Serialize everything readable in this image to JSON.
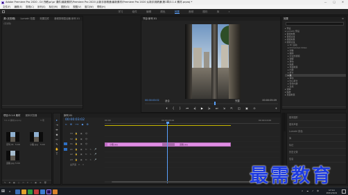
{
  "window": {
    "title": "Adobe Premiere Pro 2020 - D:\\书稿\\pr\\pr 课件\\最新素材\\Premiere Pro 2020 从新手到精通\\最新素材\\Premiere Pro 2020 从新手到精通\\第1章\\3.1.4 素材.prproj *",
    "controls": "— □ ✕"
  },
  "menu": [
    "文件(F)",
    "编辑(E)",
    "剪辑(C)",
    "序列(S)",
    "标记(M)",
    "图形(G)",
    "视图(V)",
    "窗口(W)",
    "帮助(H)"
  ],
  "workspaces": {
    "items": [
      "学习",
      "组件",
      "编辑",
      "颜色",
      "效果",
      "音频",
      "图形",
      "库"
    ],
    "active_index": 4,
    "more": "»"
  },
  "source_panel": {
    "tabs": [
      "源:(无剪辑)",
      "Lumetri 范围",
      "效果控件",
      "音频剪辑混合器:序列 01"
    ],
    "active_tab": 0,
    "subtitle": "(无剪辑)"
  },
  "program_panel": {
    "tab": "节目:序列 01",
    "timecode_current": "00:00:03:02",
    "fit": "适合",
    "quality": "完整",
    "timecode_duration": "00:00:05:09",
    "transport": [
      "⏴",
      "{",
      "}",
      "⏮",
      "◂|",
      "▶",
      "|▸",
      "⏭",
      "⇲",
      "⇱",
      "◫",
      "▣",
      "⊙"
    ],
    "add_button": "+"
  },
  "effects_panel": {
    "tab": "效果",
    "menu": "≡",
    "items": [
      {
        "label": "▸ 预设",
        "indent": 0
      },
      {
        "label": "▸ Lumetri 预设",
        "indent": 0
      },
      {
        "label": "▸ 音频效果",
        "indent": 0
      },
      {
        "label": "▸ 音频过渡",
        "indent": 0
      },
      {
        "label": "▸ 视频效果",
        "indent": 0
      },
      {
        "label": "▾ 视频过渡",
        "indent": 0
      },
      {
        "label": "▸ 3D 运动",
        "indent": 1
      },
      {
        "label": "▸ Immersive Video",
        "indent": 1
      },
      {
        "label": "▸ 划像",
        "indent": 1
      },
      {
        "label": "▸ 擦除",
        "indent": 1
      },
      {
        "label": "▸ 沉浸式视频",
        "indent": 1
      },
      {
        "label": "▸ 溶解",
        "indent": 1
      },
      {
        "label": "▸ 滑动",
        "indent": 1
      },
      {
        "label": "▸ 缩放",
        "indent": 1
      },
      {
        "label": "▸ 页面剥落",
        "indent": 1
      },
      {
        "label": "▸ 内滑",
        "indent": 1
      },
      {
        "label": "▸ 拆分",
        "indent": 1
      },
      {
        "label": "▸ 推",
        "indent": 1
      },
      {
        "label": "▸ 滑动",
        "indent": 1
      },
      {
        "label": "▸ 中心拆分",
        "indent": 1
      },
      {
        "label": "▸ 带状内滑",
        "indent": 1
      },
      {
        "label": "▸ 急摇",
        "indent": 1
      },
      {
        "label": "▸ 溶解",
        "indent": 0
      },
      {
        "label": "▸ 缩放",
        "indent": 0
      },
      {
        "label": "▸ 页面剥落",
        "indent": 0
      }
    ],
    "selected_index": 17
  },
  "project_panel": {
    "tabs": [
      "项目:3.1.4 素材",
      "媒体浏览器"
    ],
    "active_tab": 0,
    "path": "3.1.4 素材.prproj",
    "item_count": "3 项",
    "clips": [
      {
        "name": "序列 01",
        "duration": "5:09"
      },
      {
        "name": "小路.jpg",
        "duration": "5:00"
      },
      {
        "name": "道路.jpg",
        "duration": "5:00"
      }
    ],
    "bottom_icons": "✎ ≣ ▦ ○ ▭ ▾ ⌕ ▣ ⊕ 🗑"
  },
  "tools": [
    "▸",
    "⇥",
    "⇼",
    "◆",
    "↔",
    "✎",
    "✋",
    "T"
  ],
  "timeline": {
    "tab": "序列 01",
    "timecode": "00:00:03:02",
    "ruler": [
      "00:00",
      "00:00:05:00",
      "00:00:10:00"
    ],
    "tracks": [
      {
        "name": "V3",
        "target": false
      },
      {
        "name": "V2",
        "target": false
      },
      {
        "name": "V1",
        "target": true
      },
      {
        "name": "A1",
        "target": true
      },
      {
        "name": "A2",
        "target": false
      },
      {
        "name": "A3",
        "target": false
      },
      {
        "name": "主声道",
        "value": "0.0"
      }
    ],
    "clip_1": "小路.jpg",
    "clip_2": "道路.jpg",
    "fx_badge": "fx"
  },
  "essential_panel": {
    "rows": [
      "基本图形",
      "基本声音",
      "Lumetri 颜色",
      "库",
      "标记",
      "历史记录",
      "信息"
    ]
  },
  "watermark": "最需教育",
  "taskbar": {
    "time": "17:14",
    "date": "2021/3/24",
    "tray": "∧ ☁ ♪ 中"
  },
  "colors": {
    "accent": "#5aa2ff",
    "clip": "#e08ee4",
    "work_area": "#c8b800",
    "watermark": "#1f3ce0"
  }
}
